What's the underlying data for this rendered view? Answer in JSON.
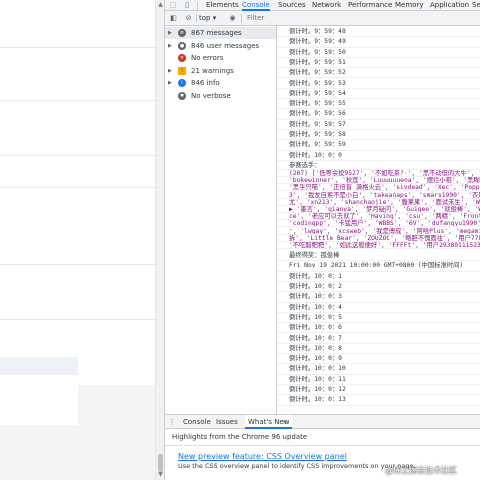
{
  "devtools": {
    "tabs": [
      "Elements",
      "Console",
      "Sources",
      "Network",
      "Performance",
      "Memory",
      "Application",
      "Se"
    ],
    "active_tab": "Console"
  },
  "toolbar": {
    "context": "top",
    "filter_placeholder": "Filter"
  },
  "sidebar": {
    "items": [
      {
        "label": "867 messages",
        "icon": "list-icon",
        "color": "#5f6368",
        "expandable": true,
        "selected": true
      },
      {
        "label": "846 user messages",
        "icon": "user-icon",
        "color": "#5f6368",
        "expandable": true,
        "selected": false
      },
      {
        "label": "No errors",
        "icon": "error-icon",
        "color": "#d93025",
        "expandable": false,
        "selected": false
      },
      {
        "label": "21 warnings",
        "icon": "warning-icon",
        "color": "#f9ab00",
        "expandable": true,
        "selected": false
      },
      {
        "label": "846 info",
        "icon": "info-icon",
        "color": "#1a73e8",
        "expandable": true,
        "selected": false
      },
      {
        "label": "No verbose",
        "icon": "verbose-icon",
        "color": "#5f6368",
        "expandable": false,
        "selected": false
      }
    ]
  },
  "console": {
    "timer_top": [
      "倒计时。9：59：48",
      "倒计时。9：59：49",
      "倒计时。9：59：50",
      "倒计时。9：59：51",
      "倒计时。9：59：52",
      "倒计时。9：59：53",
      "倒计时。9：59：54",
      "倒计时。9：59：55",
      "倒计时。9：59：56",
      "倒计时。9：59：57",
      "倒计时。9：59：58",
      "倒计时。9：59：59",
      "倒计时。10：0：0"
    ],
    "participants_label": "参赛选手：",
    "array_lines": [
      "(207) ['低等余投9527', '不如吃茶?·', '黑不动但的大牛', '",
      "'bokewinner', '秋莲', 'Luuuuuuena', '摆烂小祖', '黑糊阅",
      "'黑乎只喵', '正倍盲 满格火云', 'sivdead', 'Xec', 'Poppi",
      "3', '我龙自累不是小白', 'takeanaps', 'smars1990', '衣服归",
      "尤', 'xn213', 'shanchaojie', '腹果果', '面试未生', 'Wwww",
      "▶ '墨言', 'qianya', '梦月疑问', 'Guigee', '就俊棒', 'WIN_1",
      "ce', '老应可以去就了', 'Having', 'csu', '两精', 'Fronten",
      "'codingpp', '卡猛用户', 'WBBS', '6V', 'dufangyu1990', '",
      "', 'lwqay', 'xcsweb', '我是傅成', '阿哈Plus', 'megamin",
      "拆', 'Little_Bear', 'ZOUZOC', '略胆不愧面往', '用户7788",
      "'不吃醋粑粑', '如此这般便好', 'FFFFt', '用户293801115235"
    ],
    "winner_line": "最终得奖：孤俊棒",
    "date_line": "Fri Nov 19 2021 10:00:00 GMT+0800 (中国标准时间)",
    "timer_bottom": [
      "倒计时。10：0：1",
      "倒计时。10：0：2",
      "倒计时。10：0：3",
      "倒计时。10：0：4",
      "倒计时。10：0：5",
      "倒计时。10：0：6",
      "倒计时。10：0：7",
      "倒计时。10：0：8",
      "倒计时。10：0：9",
      "倒计时。10：0：10",
      "倒计时。10：0：11",
      "倒计时。10：0：12",
      "倒计时。10：0：13"
    ]
  },
  "drawer": {
    "tabs": [
      "Console",
      "Issues",
      "What's New"
    ],
    "active_tab": "What's New",
    "close": "×",
    "highlights": "Highlights from the Chrome 96 update",
    "news_title": "New preview feature: CSS Overview panel",
    "news_text": "Use the CSS overview panel to identify CSS improvements on your page.",
    "watermark": "@稀土掘金技术社区"
  },
  "colors": {
    "accent": "#1a73e8",
    "error": "#d93025",
    "warning": "#f9ab00"
  }
}
